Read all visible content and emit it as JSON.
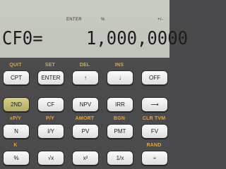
{
  "display": {
    "annunciators": {
      "enter": "ENTER",
      "pct": "%",
      "plus_minus": "+/-"
    },
    "label": "CF0=",
    "value": "1,000,0000"
  },
  "rows": [
    {
      "labels": [
        "QUIT",
        "SET",
        "DEL",
        "INS",
        ""
      ],
      "keys": [
        "CPT",
        "ENTER",
        "↑",
        "↓",
        "OFF"
      ]
    },
    {
      "labels": [
        "",
        "",
        "",
        "",
        ""
      ],
      "keys": [
        "2ND",
        "CF",
        "NPV",
        "IRR",
        "⟶"
      ]
    },
    {
      "labels": [
        "xP/Y",
        "P/Y",
        "AMORT",
        "BGN",
        "CLR TVM"
      ],
      "keys": [
        "N",
        "I/Y",
        "PV",
        "PMT",
        "FV"
      ]
    },
    {
      "labels": [
        "K",
        "",
        "",
        "",
        "RAND"
      ],
      "keys": [
        "%",
        "√x",
        "x²",
        "1/x",
        "÷"
      ]
    }
  ],
  "colors": {
    "label": "#f0a428",
    "second_key": "#c4bd72",
    "lcd": "#c5c8bf"
  }
}
